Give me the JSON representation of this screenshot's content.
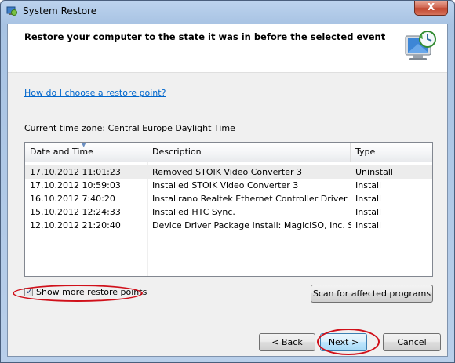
{
  "window": {
    "title": "System Restore",
    "close_label": "X"
  },
  "header": {
    "title": "Restore your computer to the state it was in before the selected event"
  },
  "help_link": "How do I choose a restore point?",
  "timezone": "Current time zone: Central Europe Daylight Time",
  "table": {
    "columns": [
      "Date and Time",
      "Description",
      "Type"
    ],
    "rows": [
      [
        "17.10.2012 11:01:23",
        "Removed STOIK Video Converter 3",
        "Uninstall"
      ],
      [
        "17.10.2012 10:59:03",
        "Installed STOIK Video Converter 3",
        "Install"
      ],
      [
        "16.10.2012 7:40:20",
        "Instalirano Realtek Ethernet Controller Driver",
        "Install"
      ],
      [
        "15.10.2012 12:24:33",
        "Installed HTC Sync.",
        "Install"
      ],
      [
        "12.10.2012 21:20:40",
        "Device Driver Package Install: MagicISO, Inc. St...",
        "Install"
      ]
    ]
  },
  "show_more": {
    "label": "Show more restore points",
    "checked": true
  },
  "buttons": {
    "scan": "Scan for affected programs",
    "back": "< Back",
    "next": "Next >",
    "cancel": "Cancel"
  },
  "colors": {
    "highlight_ellipse": "#d0101a",
    "link": "#0066cc"
  }
}
